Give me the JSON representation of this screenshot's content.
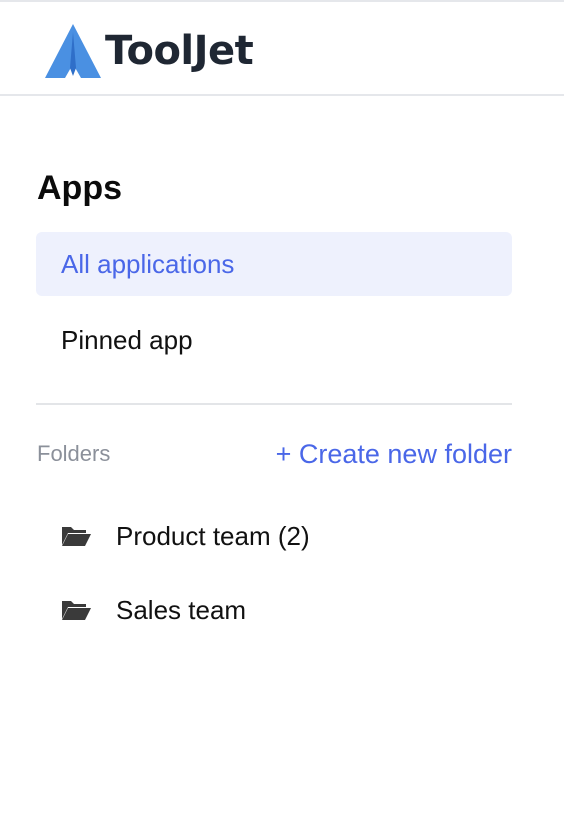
{
  "header": {
    "brand": "ToolJet",
    "brand_color": "#4a90e2"
  },
  "sidebar": {
    "title": "Apps",
    "items": [
      {
        "label": "All applications",
        "active": true
      },
      {
        "label": "Pinned app",
        "active": false
      }
    ],
    "folders_label": "Folders",
    "create_folder_label": "+ Create new folder",
    "folders": [
      {
        "label": "Product team (2)",
        "icon": "folder-open-icon"
      },
      {
        "label": "Sales team",
        "icon": "folder-open-icon"
      }
    ]
  },
  "colors": {
    "accent": "#4a67e8",
    "active_bg": "#eef1fd",
    "muted_text": "#8b909a"
  }
}
